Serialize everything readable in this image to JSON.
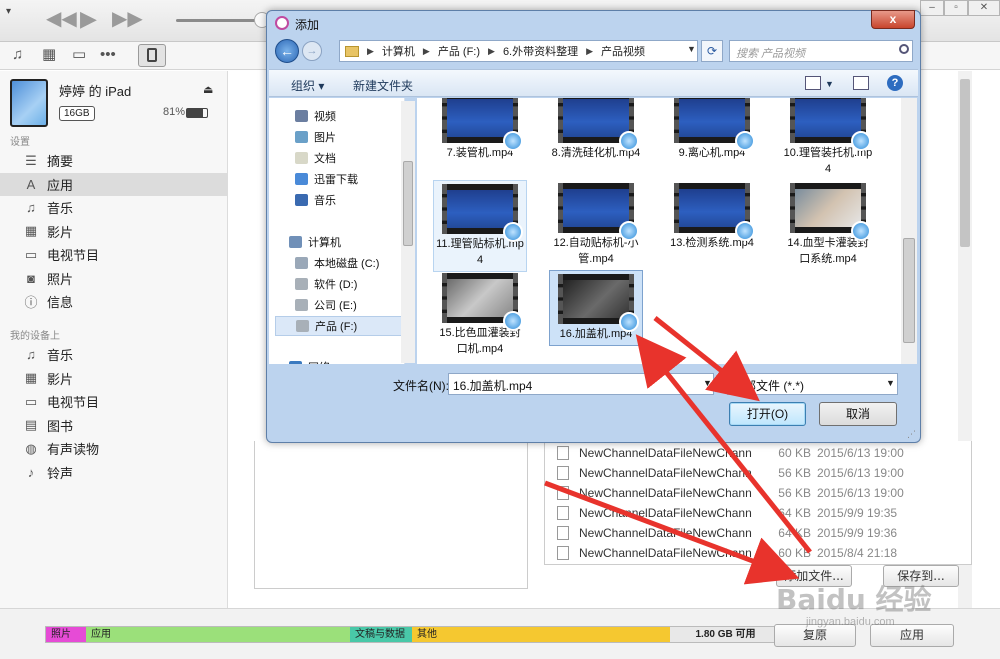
{
  "itunes": {
    "device": {
      "name": "婷婷 的 iPad",
      "capacity": "16GB",
      "battery": "81%",
      "battery_level": 0.81
    },
    "sections": {
      "settings": "设置",
      "on_device": "我的设备上"
    },
    "settings_items": [
      {
        "label": "摘要",
        "icon": "summary-icon"
      },
      {
        "label": "应用",
        "icon": "apps-icon"
      },
      {
        "label": "音乐",
        "icon": "music-note-icon"
      },
      {
        "label": "影片",
        "icon": "film-icon"
      },
      {
        "label": "电视节目",
        "icon": "tv-icon"
      },
      {
        "label": "照片",
        "icon": "camera-icon"
      },
      {
        "label": "信息",
        "icon": "info-icon"
      }
    ],
    "device_items": [
      {
        "label": "音乐",
        "icon": "music-note-icon"
      },
      {
        "label": "影片",
        "icon": "film-icon"
      },
      {
        "label": "电视节目",
        "icon": "tv-icon"
      },
      {
        "label": "图书",
        "icon": "book-icon"
      },
      {
        "label": "有声读物",
        "icon": "audiobook-icon"
      },
      {
        "label": "铃声",
        "icon": "bell-icon"
      }
    ],
    "documents": [
      {
        "name": "NewChannelDataFileNewChann",
        "size": "60 KB",
        "date": "2015/6/13 19:00"
      },
      {
        "name": "NewChannelDataFileNewChann",
        "size": "56 KB",
        "date": "2015/6/13 19:00"
      },
      {
        "name": "NewChannelDataFileNewChann",
        "size": "56 KB",
        "date": "2015/6/13 19:00"
      },
      {
        "name": "NewChannelDataFileNewChann",
        "size": "64 KB",
        "date": "2015/9/9 19:35"
      },
      {
        "name": "NewChannelDataFileNewChann",
        "size": "64 KB",
        "date": "2015/9/9 19:36"
      },
      {
        "name": "NewChannelDataFileNewChann",
        "size": "60 KB",
        "date": "2015/8/4 21:18"
      }
    ],
    "buttons": {
      "add_file": "添加文件...",
      "save_to": "保存到..."
    },
    "storage": [
      {
        "label": "照片",
        "color": "#e64bd6"
      },
      {
        "label": "应用",
        "color": "#9be07a"
      },
      {
        "label": "文稿与数据",
        "color": "#49c8a8"
      },
      {
        "label": "其他",
        "color": "#f5c830"
      },
      {
        "label": "1.80 GB 可用",
        "color": "#e8e8e8"
      }
    ],
    "bottom_buttons": {
      "restore": "复原",
      "apply": "应用"
    }
  },
  "dialog": {
    "title": "添加",
    "close": "x",
    "breadcrumb": [
      "计算机",
      "产品 (F:)",
      "6.外带资料整理",
      "产品视频"
    ],
    "search_placeholder": "搜索 产品视频",
    "organize": "组织 ▾",
    "new_folder": "新建文件夹",
    "nav_items": [
      {
        "label": "视频",
        "icon": "video-folder-icon",
        "color": "#6b7ea0"
      },
      {
        "label": "图片",
        "icon": "picture-folder-icon",
        "color": "#6aa0c8"
      },
      {
        "label": "文档",
        "icon": "document-folder-icon",
        "color": "#d8d8c8"
      },
      {
        "label": "迅雷下载",
        "icon": "download-icon",
        "color": "#4a8ad8"
      },
      {
        "label": "音乐",
        "icon": "music-folder-icon",
        "color": "#3a6ab0"
      },
      {
        "label": "计算机",
        "icon": "computer-icon",
        "color": "#7090b8"
      },
      {
        "label": "本地磁盘 (C:)",
        "icon": "drive-icon",
        "color": "#9aa8b8"
      },
      {
        "label": "软件 (D:)",
        "icon": "drive-icon",
        "color": "#a8b0b8"
      },
      {
        "label": "公司 (E:)",
        "icon": "drive-icon",
        "color": "#a8b0b8"
      },
      {
        "label": "产品 (F:)",
        "icon": "drive-icon",
        "color": "#a8b0b8"
      },
      {
        "label": "网络",
        "icon": "network-icon",
        "color": "#3a7ac0"
      }
    ],
    "files": [
      {
        "label": "7.装管机.mp4",
        "thumb": "blue"
      },
      {
        "label": "8.清洗硅化机.mp4",
        "thumb": "blue"
      },
      {
        "label": "9.离心机.mp4",
        "thumb": "blue"
      },
      {
        "label": "10.理管装托机.mp4",
        "thumb": "blue"
      },
      {
        "label": "11.理管贴标机.mp4",
        "thumb": "blue"
      },
      {
        "label": "12.自动贴标机-小管.mp4",
        "thumb": "blue"
      },
      {
        "label": "13.检测系统.mp4",
        "thumb": "blue"
      },
      {
        "label": "14.血型卡灌装封口系统.mp4",
        "thumb": "photo2"
      },
      {
        "label": "15.比色皿灌装封口机.mp4",
        "thumb": "photo"
      },
      {
        "label": "16.加盖机.mp4",
        "thumb": "dark"
      }
    ],
    "filename_label": "文件名(N):",
    "filename_value": "16.加盖机.mp4",
    "filetype_value": "全部文件 (*.*)",
    "open_button": "打开(O)",
    "cancel_button": "取消"
  },
  "watermark": {
    "brand": "Baidu 经验",
    "url": "jingyan.baidu.com"
  }
}
